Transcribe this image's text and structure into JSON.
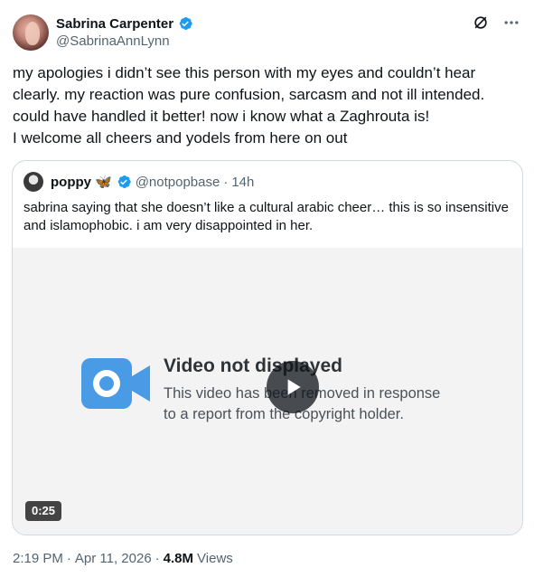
{
  "author": {
    "display_name": "Sabrina Carpenter",
    "handle": "@SabrinaAnnLynn"
  },
  "tweet": {
    "lines": [
      "my apologies i didn’t see this person with my eyes and couldn’t hear clearly. my reaction was pure confusion, sarcasm and not ill intended. could have handled it better! now i know what a Zaghrouta is!",
      "I welcome all cheers and yodels from here on out"
    ]
  },
  "quote": {
    "display_name": "poppy",
    "emoji": "🦋",
    "handle": "@notpopbase",
    "separator": "·",
    "time": "14h",
    "text": "sabrina saying that she doesn’t like a cultural arabic cheer… this is so insensitive and islamophobic. i am very disappointed in her.",
    "media": {
      "title": "Video not displayed",
      "body_line1": "This video has been removed in response",
      "body_line2": "to a report from the copyright holder.",
      "duration": "0:25",
      "icon": "video-camera-icon"
    }
  },
  "meta": {
    "time": "2:19 PM",
    "separator1": "·",
    "date": "Apr 11, 2026",
    "separator2": "·",
    "views_count": "4.8M",
    "views_label": "Views"
  },
  "colors": {
    "verified": "#1d9bf0",
    "secondary_text": "#536471",
    "border": "#cfd9de",
    "video_icon": "#4a9be6"
  }
}
